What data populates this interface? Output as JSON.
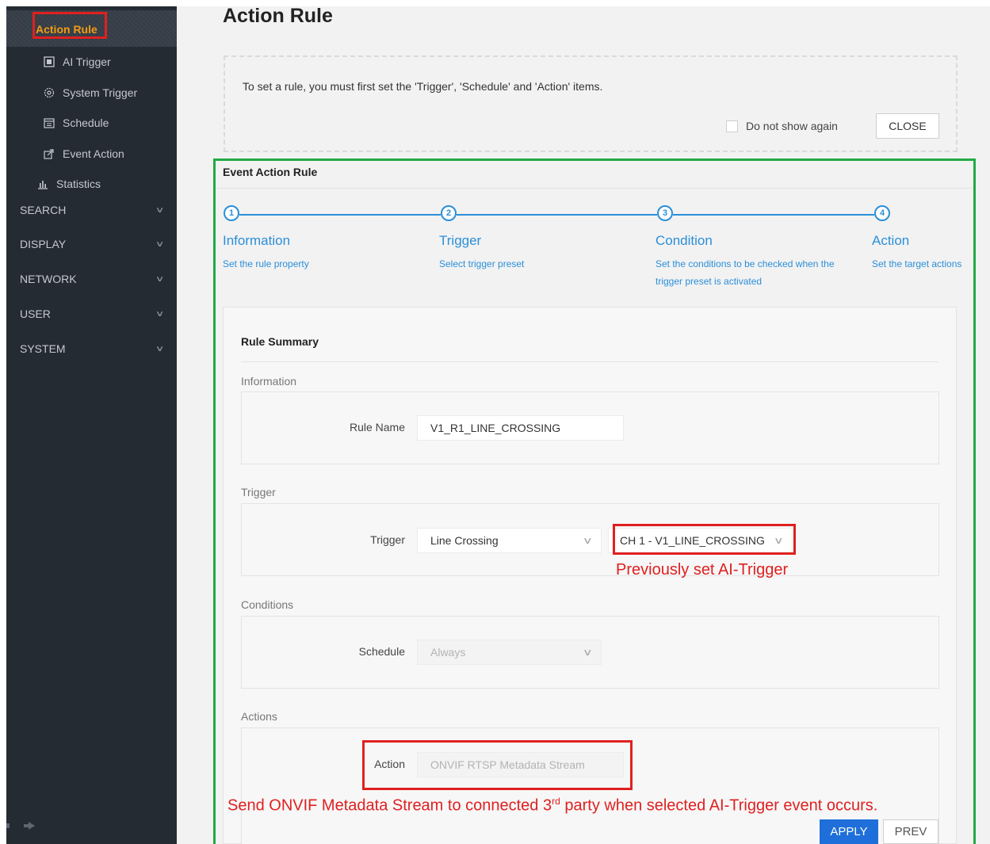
{
  "colors": {
    "accent": "#2b8fd8",
    "highlight": "#e02020",
    "green_outline": "#22aa44",
    "sidebar_bg": "#252b33",
    "active_label": "#f39c12"
  },
  "sidebar": {
    "active": "Action Rule",
    "items": [
      {
        "label": "AI Trigger",
        "icon": "ai-trigger-icon"
      },
      {
        "label": "System Trigger",
        "icon": "gear-icon"
      },
      {
        "label": "Schedule",
        "icon": "calendar-icon"
      },
      {
        "label": "Event Action",
        "icon": "share-icon"
      },
      {
        "label": "Statistics",
        "icon": "chart-icon"
      }
    ],
    "categories": [
      "SEARCH",
      "DISPLAY",
      "NETWORK",
      "USER",
      "SYSTEM"
    ]
  },
  "page_title": "Action Rule",
  "notice": {
    "text": "To set a rule, you must first set the 'Trigger', 'Schedule' and 'Action' items.",
    "checkbox_label": "Do not show again",
    "close_label": "CLOSE"
  },
  "section_title": "Event Action Rule",
  "steps": [
    {
      "num": "1",
      "title": "Information",
      "desc": "Set the rule property"
    },
    {
      "num": "2",
      "title": "Trigger",
      "desc": "Select trigger preset"
    },
    {
      "num": "3",
      "title": "Condition",
      "desc": "Set the conditions to be checked when the trigger preset is activated"
    },
    {
      "num": "4",
      "title": "Action",
      "desc": "Set the target actions"
    }
  ],
  "summary": {
    "title": "Rule Summary",
    "information": {
      "title": "Information",
      "label": "Rule Name",
      "value": "V1_R1_LINE_CROSSING"
    },
    "trigger": {
      "title": "Trigger",
      "label": "Trigger",
      "type_value": "Line Crossing",
      "preset_value": "CH 1 - V1_LINE_CROSSING"
    },
    "conditions": {
      "title": "Conditions",
      "label": "Schedule",
      "value": "Always"
    },
    "actions": {
      "title": "Actions",
      "label": "Action",
      "value": "ONVIF RTSP Metadata Stream"
    }
  },
  "annotations": {
    "trigger_note": "Previously set AI-Trigger",
    "action_note_pre": "Send ONVIF Metadata Stream to connected 3",
    "action_note_sup": "rd",
    "action_note_post": " party when selected AI-Trigger event occurs."
  },
  "buttons": {
    "apply": "APPLY",
    "prev": "PREV"
  }
}
